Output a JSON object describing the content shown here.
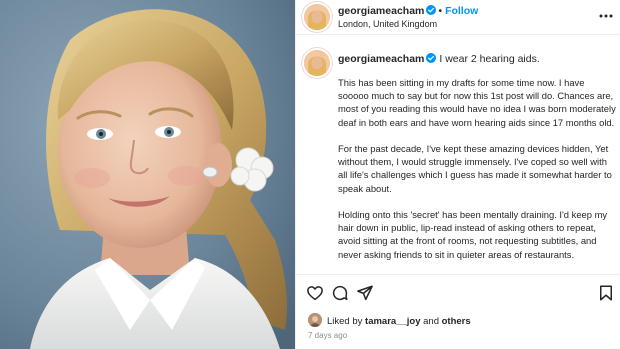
{
  "colors": {
    "accent": "#0095f6",
    "verified": "#0095f6",
    "text": "#262626",
    "muted": "#8e8e8e",
    "border": "#efefef"
  },
  "header": {
    "username": "georgiameacham",
    "separator": "•",
    "follow_label": "Follow",
    "location": "London, United Kingdom",
    "icons": {
      "verified": "verified-badge-icon",
      "more": "more-options-icon"
    }
  },
  "caption": {
    "username": "georgiameacham",
    "first_line": "I wear 2 hearing aids.",
    "paragraphs": [
      "This has been sitting in my drafts for some time now. I have sooooo much to say but for now this 1st post will do. Chances are, most of you reading this would have no idea I was born moderately deaf in both ears and have worn hearing aids since 17 months old.",
      "For the past decade, I've kept these amazing devices hidden, Yet without them, I would struggle immensely. I've coped so well with all life's challenges which I guess has made it somewhat harder to speak about.",
      "Holding onto this 'secret' has been mentally draining. I'd keep my hair down in public, lip-read instead of asking others to repeat, avoid sitting at the front of rooms, not requesting subtitles, and never asking friends to sit in quieter areas of restaurants."
    ]
  },
  "actions": {
    "icons": [
      "heart-icon",
      "comment-icon",
      "share-icon",
      "bookmark-icon"
    ],
    "likes_prefix": "Liked by",
    "liked_user": "tamara__joy",
    "likes_and": "and",
    "likes_others": "others",
    "timestamp": "7 days ago"
  }
}
